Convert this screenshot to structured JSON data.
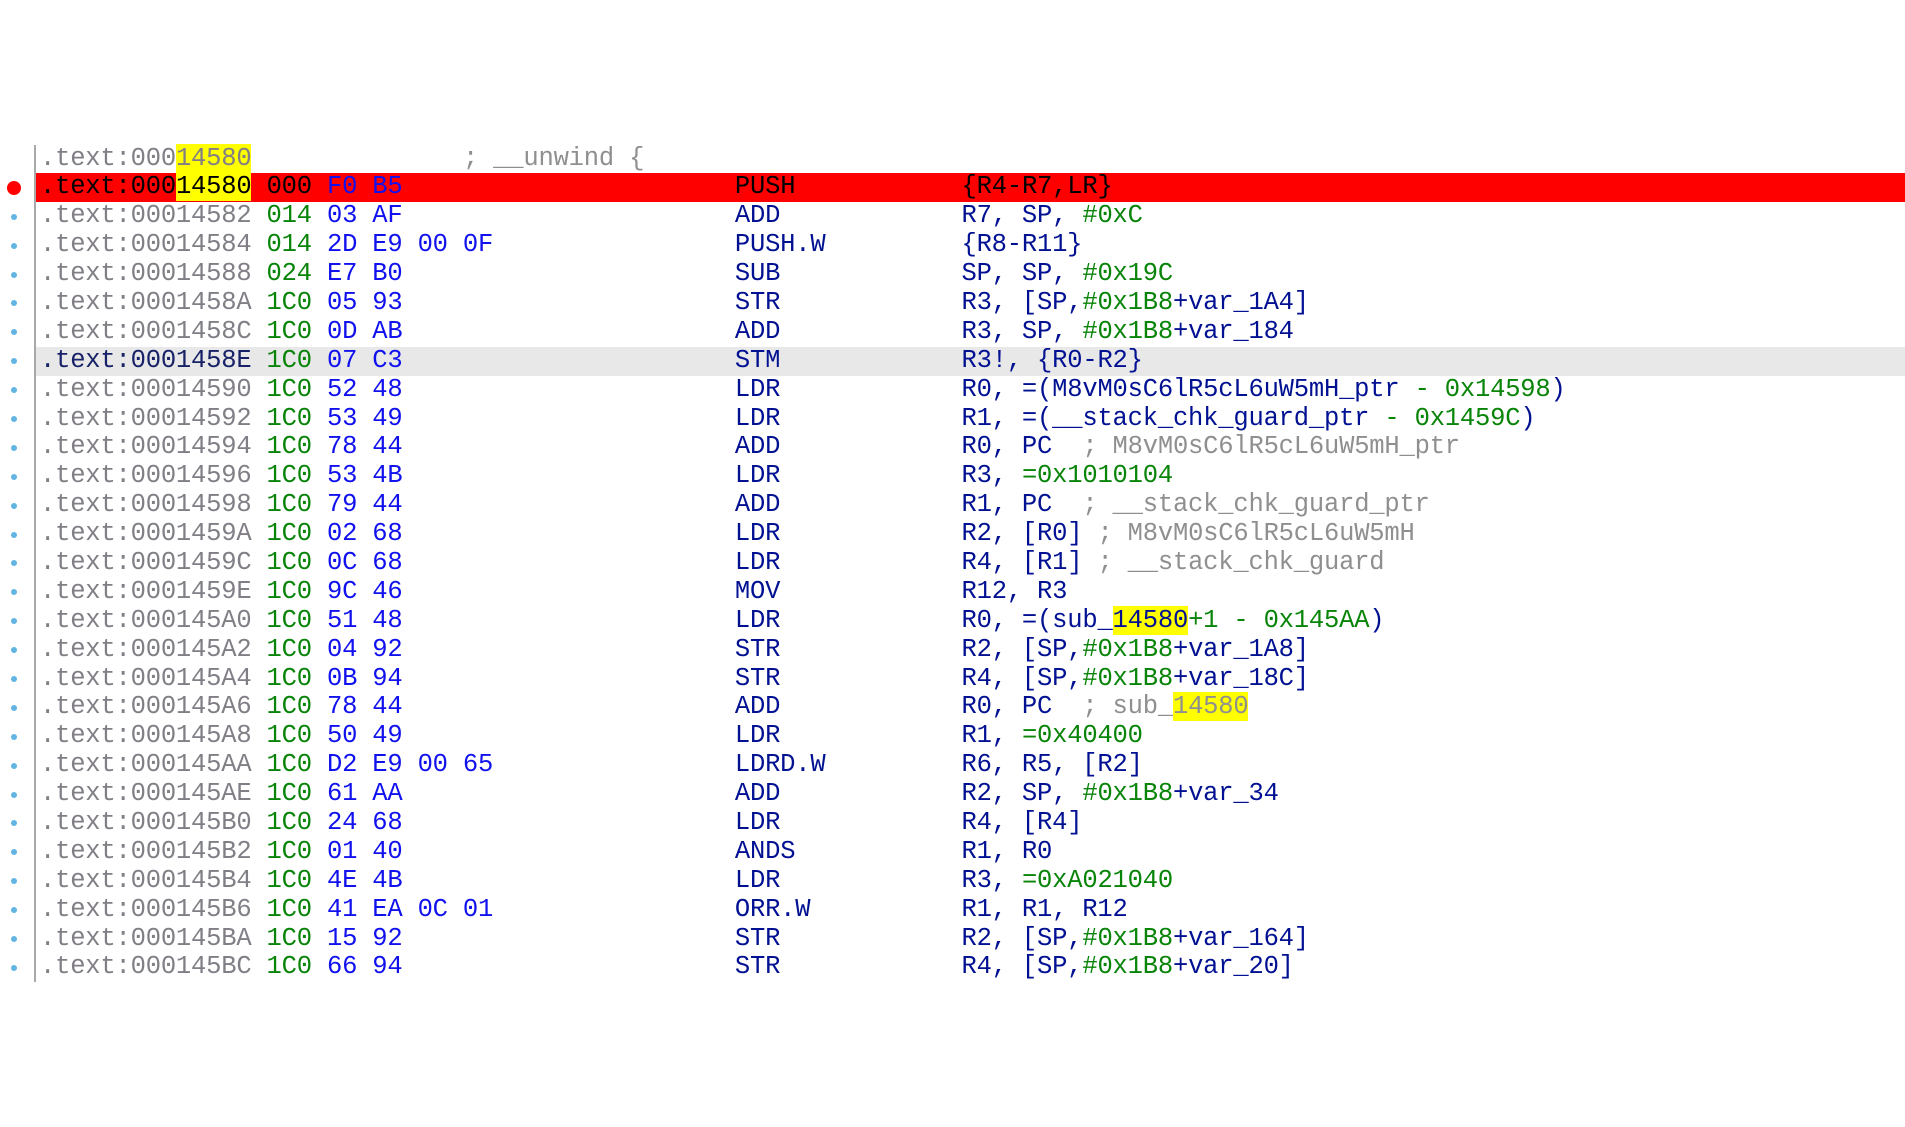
{
  "highlight_text": "14580",
  "lines": [
    {
      "shade": "none",
      "addr": ".text:00014580",
      "addr_highlight": true,
      "stack": "",
      "bytes": [],
      "mnemonic": "",
      "comment_pre": "; __unwind {",
      "operands": []
    },
    {
      "shade": "red",
      "breakpoint": true,
      "addr": ".text:00014580",
      "addr_highlight": true,
      "stack": "000",
      "bytes": [
        "F0",
        "B5"
      ],
      "mnemonic": "PUSH",
      "operands": [
        {
          "t": "nav",
          "v": "{R4-R7,LR}"
        }
      ]
    },
    {
      "shade": "none",
      "dot": true,
      "addr": ".text:00014582",
      "stack": "014",
      "bytes": [
        "03",
        "AF"
      ],
      "mnemonic": "ADD",
      "operands": [
        {
          "t": "nav",
          "v": "R7, SP, "
        },
        {
          "t": "grn",
          "v": "#0xC"
        }
      ]
    },
    {
      "shade": "none",
      "dot": true,
      "addr": ".text:00014584",
      "stack": "014",
      "bytes": [
        "2D",
        "E9",
        "00",
        "0F"
      ],
      "mnemonic": "PUSH.W",
      "operands": [
        {
          "t": "nav",
          "v": "{R8-R11}"
        }
      ]
    },
    {
      "shade": "none",
      "dot": true,
      "addr": ".text:00014588",
      "stack": "024",
      "bytes": [
        "E7",
        "B0"
      ],
      "mnemonic": "SUB",
      "operands": [
        {
          "t": "nav",
          "v": "SP, SP, "
        },
        {
          "t": "grn",
          "v": "#0x19C"
        }
      ]
    },
    {
      "shade": "none",
      "dot": true,
      "addr": ".text:0001458A",
      "stack": "1C0",
      "bytes": [
        "05",
        "93"
      ],
      "mnemonic": "STR",
      "operands": [
        {
          "t": "nav",
          "v": "R3, [SP,"
        },
        {
          "t": "grn",
          "v": "#0x1B8"
        },
        {
          "t": "nav",
          "v": "+var_1A4]"
        }
      ]
    },
    {
      "shade": "none",
      "dot": true,
      "addr": ".text:0001458C",
      "stack": "1C0",
      "bytes": [
        "0D",
        "AB"
      ],
      "mnemonic": "ADD",
      "operands": [
        {
          "t": "nav",
          "v": "R3, SP, "
        },
        {
          "t": "grn",
          "v": "#0x1B8"
        },
        {
          "t": "nav",
          "v": "+var_184"
        }
      ]
    },
    {
      "shade": "shade",
      "dot": true,
      "addr": ".text:0001458E",
      "addr_colored": true,
      "stack": "1C0",
      "bytes": [
        "07",
        "C3"
      ],
      "mnemonic": "STM",
      "operands": [
        {
          "t": "nav",
          "v": "R3!, {R0-R2}"
        }
      ]
    },
    {
      "shade": "none",
      "dot": true,
      "addr": ".text:00014590",
      "stack": "1C0",
      "bytes": [
        "52",
        "48"
      ],
      "mnemonic": "LDR",
      "operands": [
        {
          "t": "nav",
          "v": "R0, =(M8vM0sC6lR5cL6uW5mH_ptr "
        },
        {
          "t": "grn",
          "v": "- 0x14598"
        },
        {
          "t": "nav",
          "v": ")"
        }
      ]
    },
    {
      "shade": "none",
      "dot": true,
      "addr": ".text:00014592",
      "stack": "1C0",
      "bytes": [
        "53",
        "49"
      ],
      "mnemonic": "LDR",
      "operands": [
        {
          "t": "nav",
          "v": "R1, =(__stack_chk_guard_ptr "
        },
        {
          "t": "grn",
          "v": "- 0x1459C"
        },
        {
          "t": "nav",
          "v": ")"
        }
      ]
    },
    {
      "shade": "none",
      "dot": true,
      "addr": ".text:00014594",
      "stack": "1C0",
      "bytes": [
        "78",
        "44"
      ],
      "mnemonic": "ADD",
      "operands": [
        {
          "t": "nav",
          "v": "R0, PC  "
        },
        {
          "t": "gry",
          "v": "; M8vM0sC6lR5cL6uW5mH_ptr"
        }
      ]
    },
    {
      "shade": "none",
      "dot": true,
      "addr": ".text:00014596",
      "stack": "1C0",
      "bytes": [
        "53",
        "4B"
      ],
      "mnemonic": "LDR",
      "operands": [
        {
          "t": "nav",
          "v": "R3, "
        },
        {
          "t": "grn",
          "v": "=0x1010104"
        }
      ]
    },
    {
      "shade": "none",
      "dot": true,
      "addr": ".text:00014598",
      "stack": "1C0",
      "bytes": [
        "79",
        "44"
      ],
      "mnemonic": "ADD",
      "operands": [
        {
          "t": "nav",
          "v": "R1, PC  "
        },
        {
          "t": "gry",
          "v": "; __stack_chk_guard_ptr"
        }
      ]
    },
    {
      "shade": "none",
      "dot": true,
      "addr": ".text:0001459A",
      "stack": "1C0",
      "bytes": [
        "02",
        "68"
      ],
      "mnemonic": "LDR",
      "operands": [
        {
          "t": "nav",
          "v": "R2, [R0] "
        },
        {
          "t": "gry",
          "v": "; M8vM0sC6lR5cL6uW5mH"
        }
      ]
    },
    {
      "shade": "none",
      "dot": true,
      "addr": ".text:0001459C",
      "stack": "1C0",
      "bytes": [
        "0C",
        "68"
      ],
      "mnemonic": "LDR",
      "operands": [
        {
          "t": "nav",
          "v": "R4, [R1] "
        },
        {
          "t": "gry",
          "v": "; __stack_chk_guard"
        }
      ]
    },
    {
      "shade": "none",
      "dot": true,
      "addr": ".text:0001459E",
      "stack": "1C0",
      "bytes": [
        "9C",
        "46"
      ],
      "mnemonic": "MOV",
      "operands": [
        {
          "t": "nav",
          "v": "R12, R3"
        }
      ]
    },
    {
      "shade": "none",
      "dot": true,
      "addr": ".text:000145A0",
      "stack": "1C0",
      "bytes": [
        "51",
        "48"
      ],
      "mnemonic": "LDR",
      "operands": [
        {
          "t": "nav",
          "v": "R0, =(sub_"
        },
        {
          "t": "navhl",
          "v": "14580"
        },
        {
          "t": "grn",
          "v": "+1 - 0x145AA"
        },
        {
          "t": "nav",
          "v": ")"
        }
      ]
    },
    {
      "shade": "none",
      "dot": true,
      "addr": ".text:000145A2",
      "stack": "1C0",
      "bytes": [
        "04",
        "92"
      ],
      "mnemonic": "STR",
      "operands": [
        {
          "t": "nav",
          "v": "R2, [SP,"
        },
        {
          "t": "grn",
          "v": "#0x1B8"
        },
        {
          "t": "nav",
          "v": "+var_1A8]"
        }
      ]
    },
    {
      "shade": "none",
      "dot": true,
      "addr": ".text:000145A4",
      "stack": "1C0",
      "bytes": [
        "0B",
        "94"
      ],
      "mnemonic": "STR",
      "operands": [
        {
          "t": "nav",
          "v": "R4, [SP,"
        },
        {
          "t": "grn",
          "v": "#0x1B8"
        },
        {
          "t": "nav",
          "v": "+var_18C]"
        }
      ]
    },
    {
      "shade": "none",
      "dot": true,
      "addr": ".text:000145A6",
      "stack": "1C0",
      "bytes": [
        "78",
        "44"
      ],
      "mnemonic": "ADD",
      "operands": [
        {
          "t": "nav",
          "v": "R0, PC  "
        },
        {
          "t": "gry",
          "v": "; sub_"
        },
        {
          "t": "gryhl",
          "v": "14580"
        }
      ]
    },
    {
      "shade": "none",
      "dot": true,
      "addr": ".text:000145A8",
      "stack": "1C0",
      "bytes": [
        "50",
        "49"
      ],
      "mnemonic": "LDR",
      "operands": [
        {
          "t": "nav",
          "v": "R1, "
        },
        {
          "t": "grn",
          "v": "=0x40400"
        }
      ]
    },
    {
      "shade": "none",
      "dot": true,
      "addr": ".text:000145AA",
      "stack": "1C0",
      "bytes": [
        "D2",
        "E9",
        "00",
        "65"
      ],
      "mnemonic": "LDRD.W",
      "operands": [
        {
          "t": "nav",
          "v": "R6, R5, [R2]"
        }
      ]
    },
    {
      "shade": "none",
      "dot": true,
      "addr": ".text:000145AE",
      "stack": "1C0",
      "bytes": [
        "61",
        "AA"
      ],
      "mnemonic": "ADD",
      "operands": [
        {
          "t": "nav",
          "v": "R2, SP, "
        },
        {
          "t": "grn",
          "v": "#0x1B8"
        },
        {
          "t": "nav",
          "v": "+var_34"
        }
      ]
    },
    {
      "shade": "none",
      "dot": true,
      "addr": ".text:000145B0",
      "stack": "1C0",
      "bytes": [
        "24",
        "68"
      ],
      "mnemonic": "LDR",
      "operands": [
        {
          "t": "nav",
          "v": "R4, [R4]"
        }
      ]
    },
    {
      "shade": "none",
      "dot": true,
      "addr": ".text:000145B2",
      "stack": "1C0",
      "bytes": [
        "01",
        "40"
      ],
      "mnemonic": "ANDS",
      "operands": [
        {
          "t": "nav",
          "v": "R1, R0"
        }
      ]
    },
    {
      "shade": "none",
      "dot": true,
      "addr": ".text:000145B4",
      "stack": "1C0",
      "bytes": [
        "4E",
        "4B"
      ],
      "mnemonic": "LDR",
      "operands": [
        {
          "t": "nav",
          "v": "R3, "
        },
        {
          "t": "grn",
          "v": "=0xA021040"
        }
      ]
    },
    {
      "shade": "none",
      "dot": true,
      "addr": ".text:000145B6",
      "stack": "1C0",
      "bytes": [
        "41",
        "EA",
        "0C",
        "01"
      ],
      "mnemonic": "ORR.W",
      "operands": [
        {
          "t": "nav",
          "v": "R1, R1, R12"
        }
      ]
    },
    {
      "shade": "none",
      "dot": true,
      "addr": ".text:000145BA",
      "stack": "1C0",
      "bytes": [
        "15",
        "92"
      ],
      "mnemonic": "STR",
      "operands": [
        {
          "t": "nav",
          "v": "R2, [SP,"
        },
        {
          "t": "grn",
          "v": "#0x1B8"
        },
        {
          "t": "nav",
          "v": "+var_164]"
        }
      ]
    },
    {
      "shade": "none",
      "dot": true,
      "addr": ".text:000145BC",
      "stack": "1C0",
      "bytes": [
        "66",
        "94"
      ],
      "mnemonic": "STR",
      "operands": [
        {
          "t": "nav",
          "v": "R4, [SP,"
        },
        {
          "t": "grn",
          "v": "#0x1B8"
        },
        {
          "t": "nav",
          "v": "+var_20]"
        }
      ]
    }
  ],
  "layout": {
    "addr_width_ch": 14,
    "stack_col_start_ch": 15,
    "bytes_col_start_ch": 19,
    "comment_col_start_ch": 31,
    "mnemonic_col_start_ch": 46,
    "operand_col_start_ch": 61
  }
}
